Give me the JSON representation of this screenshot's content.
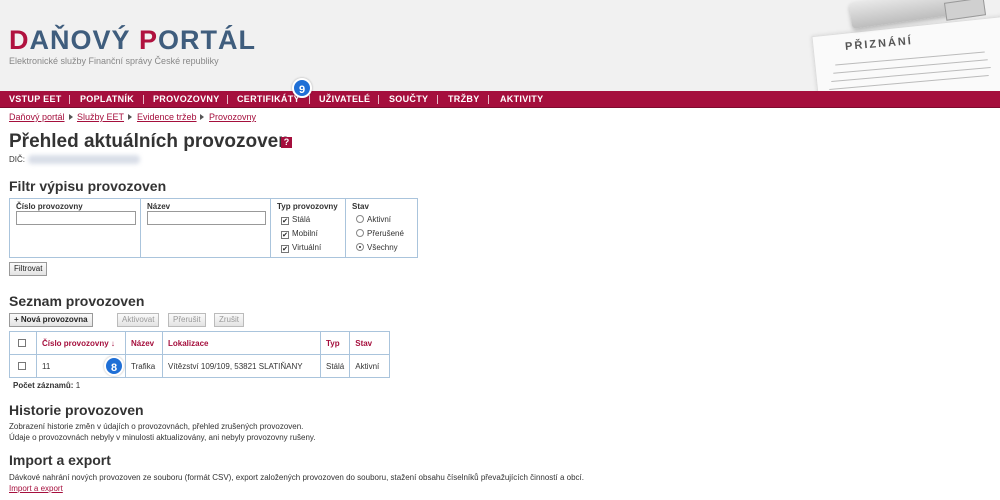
{
  "header": {
    "logo_first_letter": "D",
    "logo_first_rest": "AŇOVÝ ",
    "logo_second_letter": "P",
    "logo_second_rest": "ORTÁL",
    "tagline": "Elektronické služby Finanční správy České republiky",
    "decoration_title": "PŘIZNÁNÍ"
  },
  "nav": {
    "items": [
      "VSTUP EET",
      "POPLATNÍK",
      "PROVOZOVNY",
      "CERTIFIKÁTY",
      "UŽIVATELÉ",
      "SOUČTY",
      "TRŽBY",
      "AKTIVITY"
    ]
  },
  "badges": {
    "nav_badge": "9",
    "table_badge": "8"
  },
  "breadcrumb": [
    "Daňový portál",
    "Služby EET",
    "Evidence tržeb",
    "Provozovny"
  ],
  "page": {
    "title": "Přehled aktuálních provozoven",
    "help_label": "?",
    "dic_label": "DIČ:"
  },
  "filter": {
    "heading": "Filtr výpisu provozoven",
    "col_number": "Číslo provozovny",
    "col_name": "Název",
    "col_type": "Typ provozovny",
    "col_state": "Stav",
    "type_options": [
      {
        "label": "Stálá",
        "checked": true
      },
      {
        "label": "Mobilní",
        "checked": true
      },
      {
        "label": "Virtuální",
        "checked": true
      }
    ],
    "state_options": [
      {
        "label": "Aktivní",
        "selected": false
      },
      {
        "label": "Přerušené",
        "selected": false
      },
      {
        "label": "Všechny",
        "selected": true
      }
    ],
    "number_value": "",
    "name_value": "",
    "submit_label": "Filtrovat"
  },
  "list": {
    "heading": "Seznam provozoven",
    "new_button": "+ Nová provozovna",
    "activate_button": "Aktivovat",
    "interrupt_button": "Přerušit",
    "cancel_button": "Zrušit",
    "columns": [
      "Číslo provozovny ↓",
      "Název",
      "Lokalizace",
      "Typ",
      "Stav"
    ],
    "rows": [
      {
        "number": "11",
        "name": "Trafika",
        "location": "Vítězství 109/109, 53821 SLATIŇANY",
        "type": "Stálá",
        "state": "Aktivní"
      }
    ],
    "count_label": "Počet záznamů:",
    "count_value": "1"
  },
  "history": {
    "heading": "Historie provozoven",
    "line1": "Zobrazení historie změn v údajích o provozovnách, přehled zrušených provozoven.",
    "line2": "Údaje o provozovnách nebyly v minulosti aktualizovány, ani nebyly provozovny rušeny."
  },
  "import": {
    "heading": "Import a export",
    "text": "Dávkové nahrání nových provozoven ze souboru (formát CSV), export založených provozoven do souboru, stažení obsahu číselníků převažujících činností a obcí.",
    "link": "Import a export"
  },
  "colors": {
    "brand": "#a50f3d",
    "logo_blue": "#3f5d7d",
    "badge": "#1f6fd6",
    "border": "#aac4dc"
  }
}
